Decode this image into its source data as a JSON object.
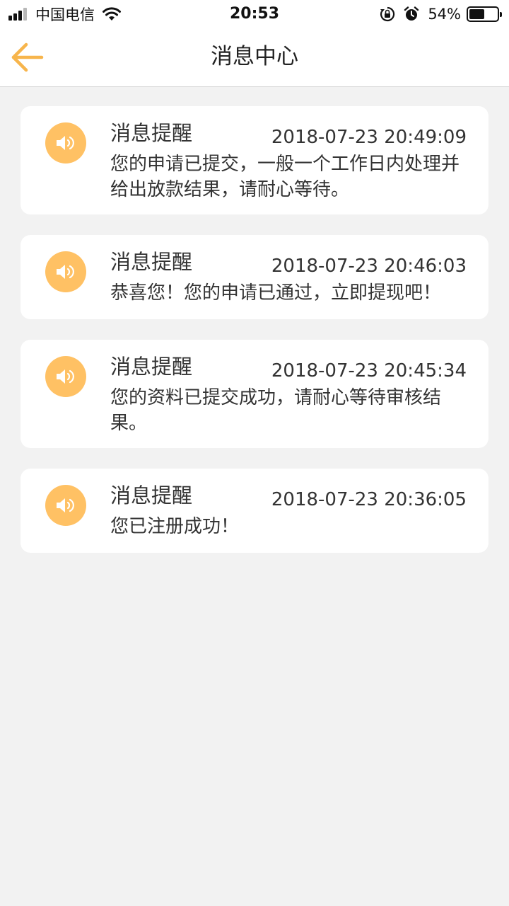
{
  "status_bar": {
    "carrier": "中国电信",
    "time": "20:53",
    "battery": "54%",
    "battery_level": 0.54
  },
  "nav": {
    "title": "消息中心",
    "back_icon": "arrow-left-icon",
    "accent_color": "#f7b54c"
  },
  "messages": [
    {
      "title": "消息提醒",
      "time": "2018-07-23 20:49:09",
      "body": "您的申请已提交，一般一个工作日内处理并给出放款结果，请耐心等待。",
      "icon": "speaker-icon"
    },
    {
      "title": "消息提醒",
      "time": "2018-07-23 20:46:03",
      "body": "恭喜您！您的申请已通过，立即提现吧！",
      "icon": "speaker-icon"
    },
    {
      "title": "消息提醒",
      "time": "2018-07-23 20:45:34",
      "body": "您的资料已提交成功，请耐心等待审核结果。",
      "icon": "speaker-icon"
    },
    {
      "title": "消息提醒",
      "time": "2018-07-23 20:36:05",
      "body": "您已注册成功！",
      "icon": "speaker-icon"
    }
  ]
}
